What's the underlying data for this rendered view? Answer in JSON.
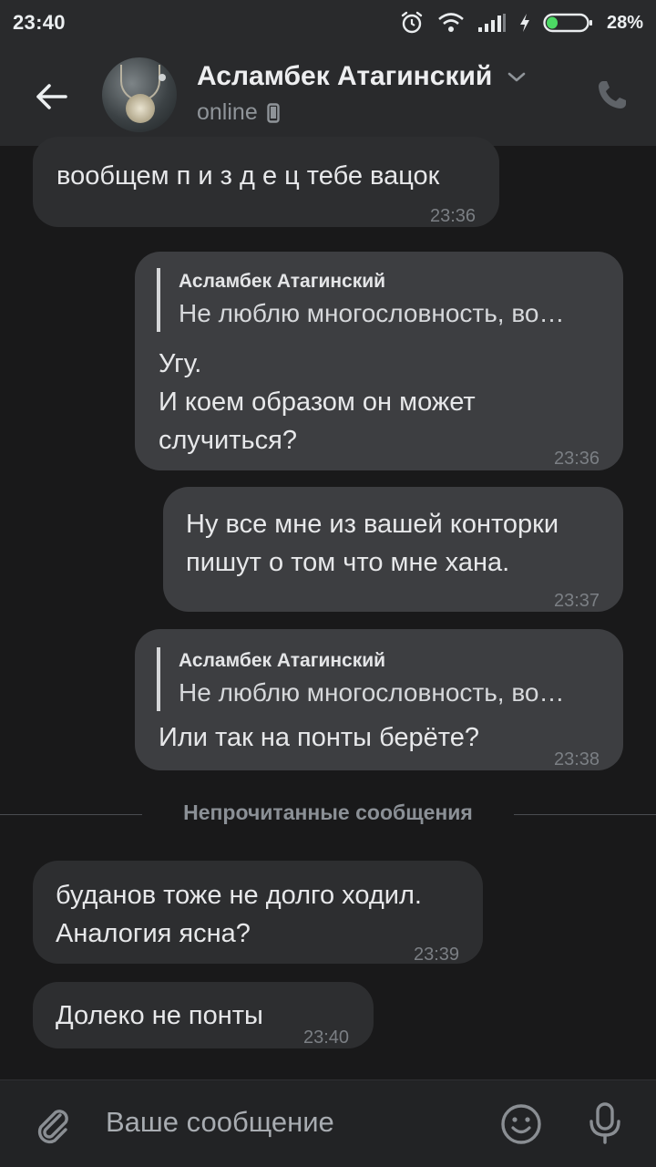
{
  "status_bar": {
    "time": "23:40",
    "battery_percent": "28%",
    "icons": [
      "alarm-icon",
      "wifi-icon",
      "signal-icon",
      "charging-icon",
      "battery-icon"
    ],
    "battery_level": 0.28
  },
  "header": {
    "contact_name": "Асламбек Атагинский",
    "presence": "online",
    "icons": [
      "back-arrow-icon",
      "chevron-down-icon",
      "mobile-device-icon",
      "phone-icon"
    ]
  },
  "messages": [
    {
      "id": "m1",
      "direction": "incoming",
      "lines": [
        "вообщем п и з д е ц тебе вацок"
      ],
      "time": "23:36"
    },
    {
      "id": "m2",
      "direction": "outgoing",
      "reply": {
        "author": "Асламбек Атагинский",
        "text": "Не люблю многословность, во…"
      },
      "lines": [
        "Угу.",
        "И коем образом он может",
        "случиться?"
      ],
      "time": "23:36"
    },
    {
      "id": "m3",
      "direction": "outgoing",
      "lines": [
        "Ну все мне из вашей конторки",
        "пишут о том что мне хана."
      ],
      "time": "23:37"
    },
    {
      "id": "m4",
      "direction": "outgoing",
      "reply": {
        "author": "Асламбек Атагинский",
        "text": "Не люблю многословность, во…"
      },
      "lines": [
        "Или так на понты берёте?"
      ],
      "time": "23:38"
    },
    {
      "id": "m5",
      "direction": "incoming",
      "lines": [
        "буданов тоже не долго ходил.",
        "Аналогия ясна?"
      ],
      "time": "23:39"
    },
    {
      "id": "m6",
      "direction": "incoming",
      "lines": [
        "Долеко не понты"
      ],
      "time": "23:40"
    }
  ],
  "unread_divider": "Непрочитанные сообщения",
  "composer": {
    "placeholder": "Ваше сообщение",
    "icons": [
      "paperclip-icon",
      "emoji-icon",
      "microphone-icon"
    ]
  },
  "colors": {
    "background": "#19191a",
    "bar": "#292a2c",
    "incoming_bubble": "#2d2e30",
    "outgoing_bubble": "#3d3e41",
    "battery_accent": "#4cd964"
  }
}
